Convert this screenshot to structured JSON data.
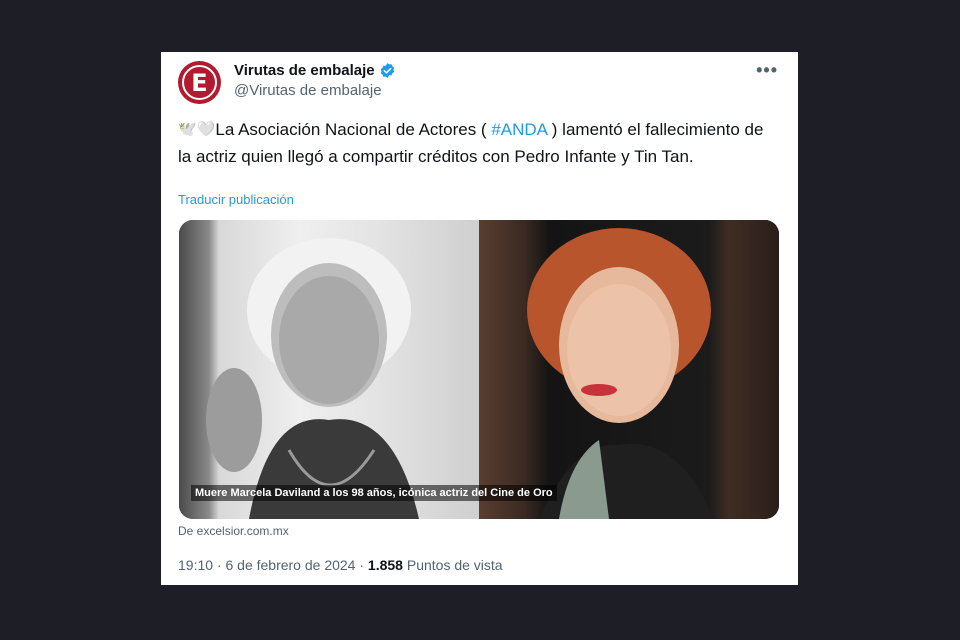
{
  "tweet": {
    "author": {
      "display_name": "Virutas de embalaje",
      "handle": "@Virutas de embalaje",
      "avatar_letter": "E",
      "avatar_color": "#b11a2f",
      "verified_icon": "verified-badge-icon",
      "verified_color": "#1d9bf0"
    },
    "more_label": "•••",
    "text": {
      "emoji_1": "🕊️",
      "emoji_2": "🤍",
      "part_1": "La Asociación Nacional de Actores ( ",
      "hashtag": "#ANDA",
      "part_2": " ) lamentó el fallecimiento de la actriz quien llegó a compartir créditos con Pedro Infante y Tin Tan."
    },
    "translate_label": "Traducir publicación",
    "media": {
      "caption": "Muere Marcela Daviland a los 98 años, icónica actriz del Cine de Oro"
    },
    "source": "De excelsior.com.mx",
    "timestamp": "19:10 · 6 de febrero de 2024 · ",
    "views_count": "1.858",
    "views_label": " Puntos de vista",
    "link_color": "#1d9bf0"
  }
}
